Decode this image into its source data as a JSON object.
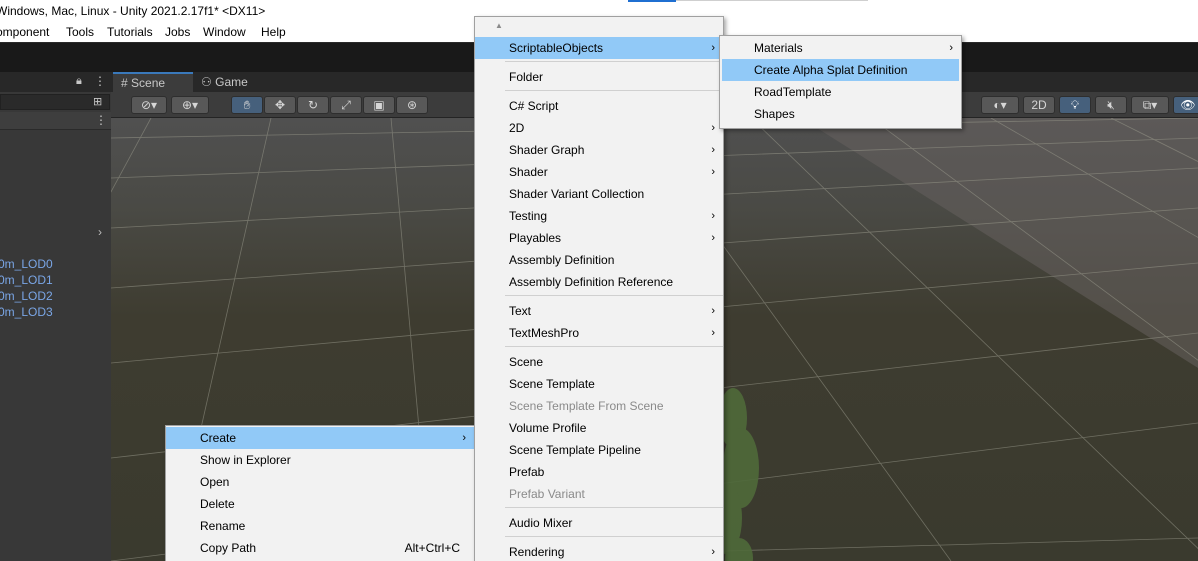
{
  "titlebar": {
    "title": "Windows, Mac, Linux - Unity 2021.2.17f1* <DX11>"
  },
  "menubar": {
    "items": [
      "omponent",
      "Tools",
      "Tutorials",
      "Jobs",
      "Window",
      "Help"
    ]
  },
  "hierarchy": {
    "lod_items": [
      "0m_LOD0",
      "0m_LOD1",
      "0m_LOD2",
      "0m_LOD3"
    ]
  },
  "scene_tabs": [
    {
      "label": "Scene",
      "icon": "grid-icon"
    },
    {
      "label": "Game",
      "icon": "gamepad-icon"
    }
  ],
  "scene_toolbar": {
    "mode_2d": "2D"
  },
  "project_menu": {
    "items": [
      {
        "label": "Create",
        "submenu": true,
        "highlighted": true
      },
      {
        "label": "Show in Explorer"
      },
      {
        "label": "Open"
      },
      {
        "label": "Delete"
      },
      {
        "label": "Rename"
      },
      {
        "label": "Copy Path",
        "shortcut": "Alt+Ctrl+C"
      }
    ]
  },
  "create_menu": {
    "scroll_up": "▲",
    "items": [
      {
        "label": "ScriptableObjects",
        "submenu": true,
        "highlighted": true
      },
      {
        "label": "Folder"
      },
      {
        "label": "C# Script"
      },
      {
        "label": "2D",
        "submenu": true
      },
      {
        "label": "Shader Graph",
        "submenu": true
      },
      {
        "label": "Shader",
        "submenu": true
      },
      {
        "label": "Shader Variant Collection"
      },
      {
        "label": "Testing",
        "submenu": true
      },
      {
        "label": "Playables",
        "submenu": true
      },
      {
        "label": "Assembly Definition"
      },
      {
        "label": "Assembly Definition Reference"
      },
      {
        "label": "Text",
        "submenu": true
      },
      {
        "label": "TextMeshPro",
        "submenu": true
      },
      {
        "label": "Scene"
      },
      {
        "label": "Scene Template"
      },
      {
        "label": "Scene Template From Scene",
        "disabled": true
      },
      {
        "label": "Volume Profile"
      },
      {
        "label": "Scene Template Pipeline"
      },
      {
        "label": "Prefab"
      },
      {
        "label": "Prefab Variant",
        "disabled": true
      },
      {
        "label": "Audio Mixer"
      },
      {
        "label": "Rendering",
        "submenu": true
      }
    ]
  },
  "scriptable_menu": {
    "items": [
      {
        "label": "Materials",
        "submenu": true
      },
      {
        "label": "Create Alpha Splat Definition",
        "highlighted": true
      },
      {
        "label": "RoadTemplate"
      },
      {
        "label": "Shapes"
      }
    ]
  },
  "colors": {
    "menu_highlight": "#91c9f7",
    "menu_bg": "#f2f2f2",
    "lod_text": "#7aa6e6"
  }
}
